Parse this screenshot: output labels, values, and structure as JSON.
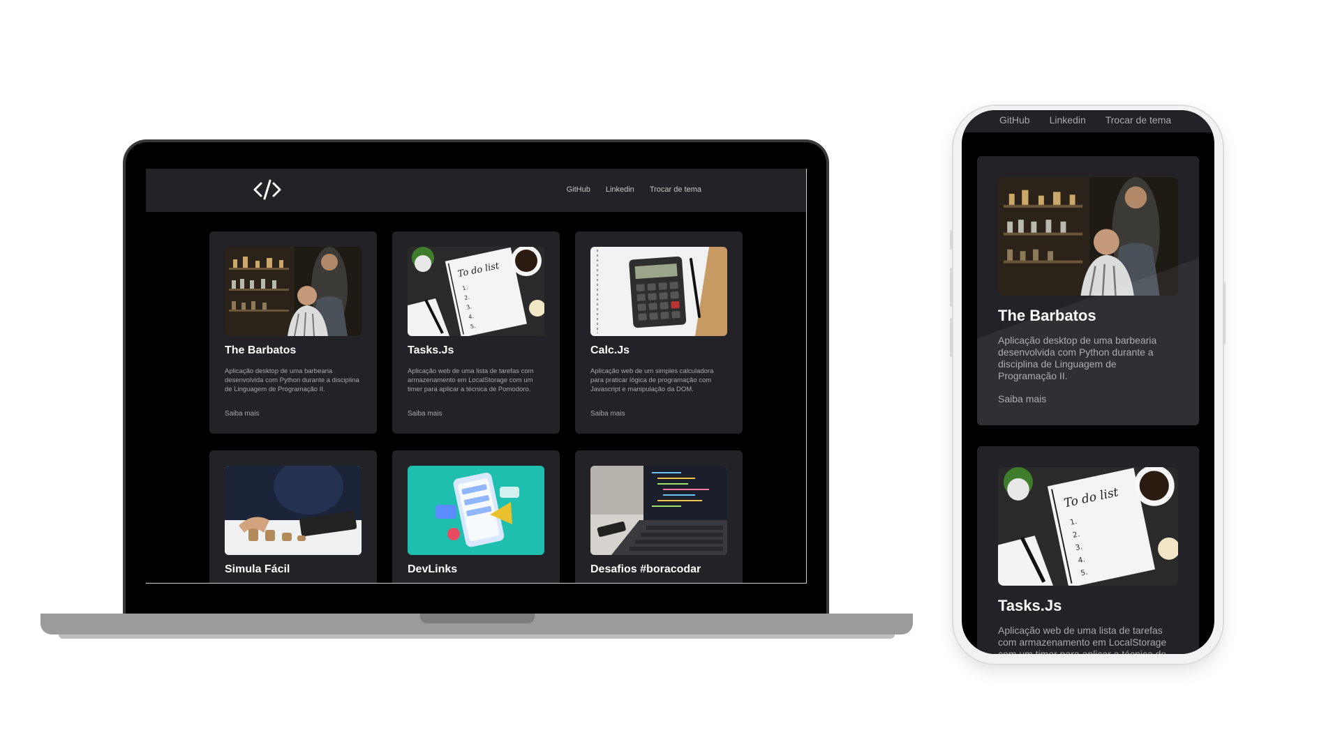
{
  "site": {
    "nav": [
      "GitHub",
      "Linkedin",
      "Trocar de tema"
    ],
    "logo_icon": "code-brackets-icon"
  },
  "laptop": {
    "projects": [
      {
        "title": "The Barbatos",
        "description": "Aplicação desktop de uma barbearia desenvolvida com Python durante a disciplina de Linguagem de Programação II.",
        "link": "Saiba mais",
        "image": "barbershop-photo"
      },
      {
        "title": "Tasks.Js",
        "description": "Aplicação web de uma lista de tarefas com armazenamento em LocalStorage com um timer para aplicar a técnica de Pomodoro.",
        "link": "Saiba mais",
        "image": "todo-list-photo"
      },
      {
        "title": "Calc.Js",
        "description": "Aplicação web de um simples calculadora para praticar lógica de programação com Javascript e manipulação da DOM.",
        "link": "Saiba mais",
        "image": "calculator-photo"
      },
      {
        "title": "Simula Fácil",
        "image": "coins-calculator-photo"
      },
      {
        "title": "DevLinks",
        "image": "social-phone-illustration"
      },
      {
        "title": "Desafios #boracodar",
        "image": "laptop-code-photo"
      }
    ]
  },
  "phone": {
    "nav": [
      "GitHub",
      "Linkedin",
      "Trocar de tema"
    ],
    "projects": [
      {
        "title": "The Barbatos",
        "description": "Aplicação desktop de uma barbearia desenvolvida com Python durante a disciplina de Linguagem de Programação II.",
        "link": "Saiba mais"
      },
      {
        "title": "Tasks.Js",
        "description": "Aplicação web de uma lista de tarefas com armazenamento em LocalStorage com um timer para aplicar a técnica de"
      }
    ]
  },
  "colors": {
    "page_bg": "#000000",
    "card_bg": "#232327",
    "header_bg": "#232327",
    "title": "#ffffff",
    "muted": "#a8a8ad"
  }
}
